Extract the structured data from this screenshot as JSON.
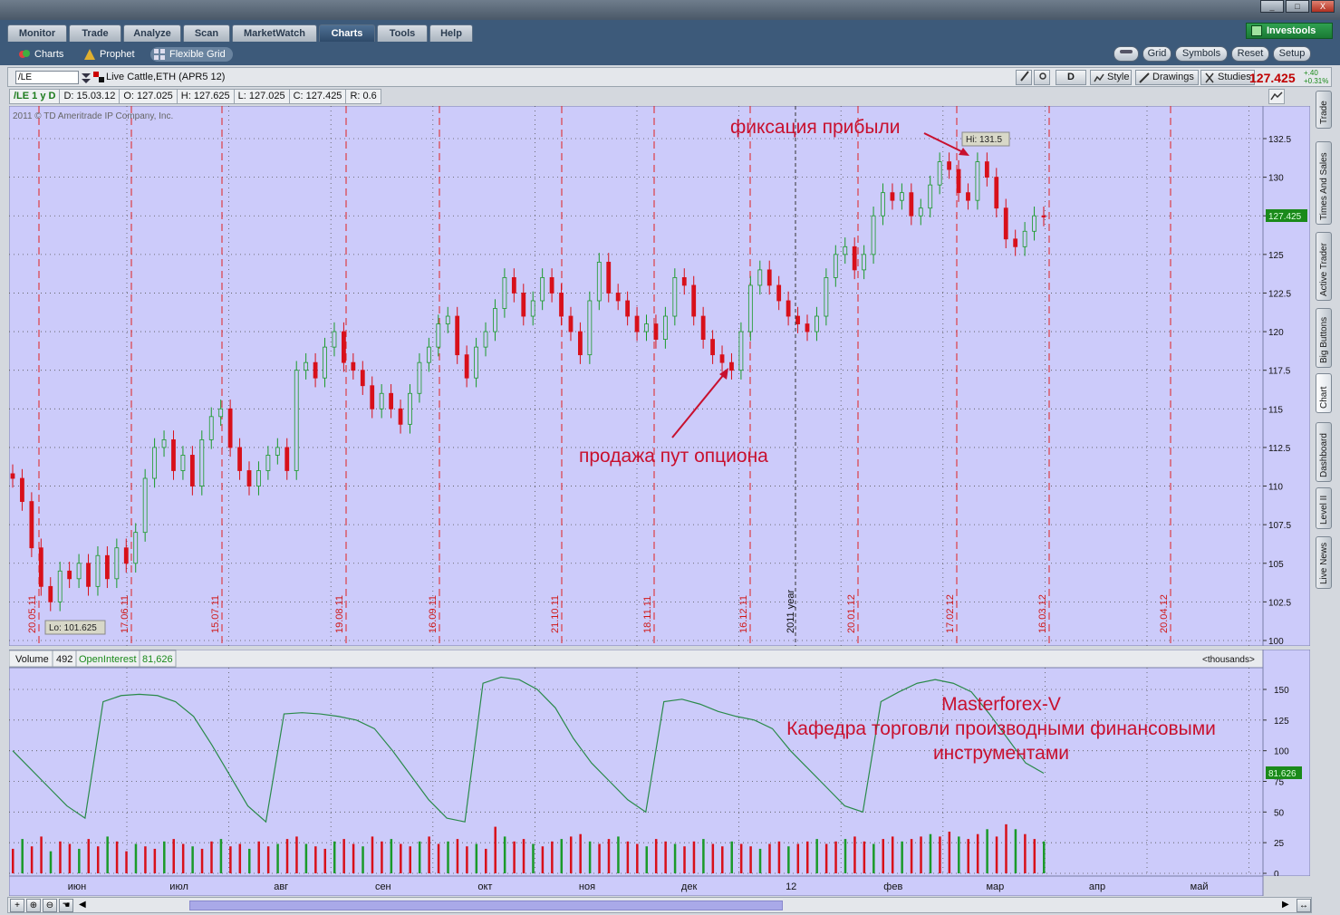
{
  "window": {
    "minimize": "_",
    "maximize": "□",
    "close": "X"
  },
  "main_tabs": [
    {
      "label": "Monitor",
      "active": false
    },
    {
      "label": "Trade",
      "active": false
    },
    {
      "label": "Analyze",
      "active": false
    },
    {
      "label": "Scan",
      "active": false
    },
    {
      "label": "MarketWatch",
      "active": false
    },
    {
      "label": "Charts",
      "active": true
    },
    {
      "label": "Tools",
      "active": false
    },
    {
      "label": "Help",
      "active": false
    }
  ],
  "brand": "Investools",
  "sub_tabs": [
    {
      "label": "Charts",
      "icon": "charts-icon"
    },
    {
      "label": "Prophet",
      "icon": "prophet-icon"
    },
    {
      "label": "Flexible Grid",
      "icon": "grid-icon"
    }
  ],
  "right_buttons": [
    "Grid",
    "Symbols",
    "Reset",
    "Setup"
  ],
  "symbol": {
    "value": "/LE",
    "description": "Live Cattle,ETH (APR5 12)",
    "period": "D",
    "style": "Style",
    "drawings": "Drawings",
    "studies": "Studies",
    "last": "127.425",
    "change": "+.40",
    "change_pct": "+0.31%"
  },
  "ohlc": {
    "key": "/LE 1 y D",
    "date": "D: 15.03.12",
    "open": "O: 127.025",
    "high": "H: 127.625",
    "low": "L: 127.025",
    "close": "C: 127.425",
    "range": "R: 0.6"
  },
  "copyright": "2011 © TD Ameritrade IP Company, Inc.",
  "annotations": {
    "profit": "фиксация прибыли",
    "put": "продажа пут опциона",
    "hi_label": "Hi: 131.5",
    "lo_label": "Lo: 101.625",
    "year_label": "2011 year",
    "watermark_line1": "Masterforex-V",
    "watermark_line2": "Кафедра торговли производными финансовыми",
    "watermark_line3": "инструментами"
  },
  "volume_header": {
    "volume_label": "Volume",
    "volume_value": "492",
    "oi_label": "OpenInterest",
    "oi_value": "81,626",
    "units": "<thousands>",
    "oi_badge": "81.626"
  },
  "side_tabs": [
    "Trade",
    "Times And Sales",
    "Active Trader",
    "Big Buttons",
    "Chart",
    "Dashboard",
    "Level II",
    "Live News"
  ],
  "chart_data": {
    "type": "candlestick",
    "price_axis": {
      "ticks": [
        "132.5",
        "130",
        "127.5",
        "125",
        "122.5",
        "120",
        "117.5",
        "115",
        "112.5",
        "110",
        "107.5",
        "105",
        "102.5",
        "100"
      ],
      "min": 100,
      "max": 132.5,
      "last_badge": "127.425"
    },
    "volume_axis": {
      "ticks": [
        "150",
        "125",
        "100",
        "75",
        "50",
        "25",
        "0"
      ],
      "min": 0,
      "max": 150
    },
    "date_markers": [
      "20.05.11",
      "17.06.11",
      "15.07.11",
      "19.08.11",
      "16.09.11",
      "21.10.11",
      "18.11.11",
      "16.12.11",
      "20.01.12",
      "17.02.12",
      "16.03.12",
      "20.04.12"
    ],
    "month_labels": [
      "июн",
      "июл",
      "авг",
      "сен",
      "окт",
      "ноя",
      "дек",
      "12",
      "фев",
      "мар",
      "апр",
      "май"
    ],
    "high": 131.5,
    "low": 101.625,
    "price_path": [
      110.5,
      109,
      106,
      103.5,
      102.5,
      104.5,
      104,
      105,
      103.5,
      105.5,
      104,
      106,
      105,
      107,
      110.5,
      112.5,
      113,
      111,
      112,
      110,
      113,
      114.5,
      115,
      112.5,
      111,
      110,
      111,
      112,
      112.5,
      111,
      117.5,
      118,
      117,
      119,
      120,
      118,
      117.5,
      116.5,
      115,
      116,
      115,
      114,
      116,
      118,
      119,
      120.5,
      121,
      118.5,
      117,
      119,
      120,
      121.5,
      123.5,
      122.5,
      121,
      122,
      123.5,
      122.5,
      121,
      120,
      118.5,
      122,
      124.5,
      122.5,
      122,
      121,
      120,
      120.5,
      119.5,
      121,
      123.5,
      123,
      121,
      119.5,
      118.5,
      118,
      117.5,
      120,
      123,
      124,
      123,
      122,
      121,
      120.5,
      120,
      121,
      123.5,
      125,
      125.5,
      124,
      125,
      127.5,
      129,
      128.5,
      129,
      127.5,
      128,
      129.5,
      131,
      130.5,
      129,
      128.5,
      131,
      130,
      128,
      126,
      125.5,
      126.5,
      127.5,
      127.425
    ],
    "volume_bars": [
      20,
      28,
      22,
      30,
      18,
      26,
      24,
      20,
      28,
      22,
      30,
      26,
      18,
      24,
      22,
      20,
      26,
      28,
      24,
      22,
      20,
      26,
      28,
      22,
      24,
      20,
      26,
      22,
      24,
      28,
      30,
      24,
      22,
      20,
      26,
      28,
      24,
      22,
      30,
      26,
      28,
      24,
      22,
      26,
      30,
      24,
      26,
      28,
      22,
      24,
      20,
      38,
      30,
      26,
      28,
      24,
      22,
      26,
      28,
      30,
      32,
      26,
      24,
      28,
      30,
      26,
      24,
      22,
      28,
      26,
      24,
      22,
      26,
      28,
      24,
      22,
      26,
      24,
      22,
      20,
      24,
      26,
      22,
      24,
      26,
      28,
      24,
      26,
      28,
      30,
      26,
      24,
      28,
      30,
      26,
      28,
      30,
      32,
      30,
      34,
      30,
      28,
      32,
      36,
      30,
      40,
      36,
      32,
      28,
      26
    ],
    "open_interest_path": [
      100,
      85,
      70,
      55,
      45,
      140,
      145,
      146,
      145,
      140,
      128,
      105,
      80,
      55,
      42,
      130,
      131,
      130,
      128,
      125,
      118,
      100,
      80,
      60,
      45,
      42,
      155,
      160,
      158,
      150,
      135,
      110,
      90,
      75,
      60,
      50,
      140,
      142,
      138,
      132,
      128,
      125,
      118,
      100,
      85,
      70,
      55,
      50,
      140,
      148,
      155,
      158,
      155,
      148,
      130,
      110,
      90,
      81.626
    ]
  }
}
